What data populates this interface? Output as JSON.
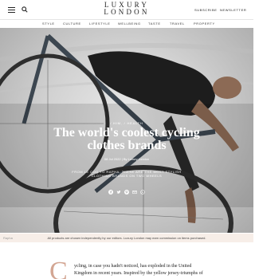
{
  "header": {
    "logo_line1": "LUXURY",
    "logo_line2": "LONDON",
    "subscribe": "SUBSCRIBE",
    "newsletter": "NEWSLETTER"
  },
  "nav": {
    "items": [
      "STYLE",
      "CULTURE",
      "LIFESTYLE",
      "WELLBEING",
      "TASTE",
      "TRAVEL",
      "PROPERTY"
    ]
  },
  "hero": {
    "kicker": "/ HIM, / HEALTH",
    "title": "The world's coolest cycling clothes brands",
    "date": "08 Jul 2022",
    "author": "By Luxury London",
    "standfirst": "FROM LE COQ TO RAPHA, THESE ARE THE MOST STYLISH CLOTHING BRANDS ON TWO WHEELS",
    "share_icons": [
      "facebook-icon",
      "twitter-icon",
      "pinterest-icon",
      "email-icon",
      "whatsapp-icon"
    ],
    "caption": "Rapha"
  },
  "disclaimer": "All products are chosen independently by our editors. Luxury London may earn commission on items purchased.",
  "article": {
    "dropcap": "C",
    "line1": "ycling, in case you hadn't noticed, has exploded in the United",
    "line2": "Kingdom in recent years. Inspired by the yellow jersey-triumphs of"
  },
  "colors": {
    "dropcap": "#d3a693",
    "disclaimer_bg": "#f7eee8"
  }
}
